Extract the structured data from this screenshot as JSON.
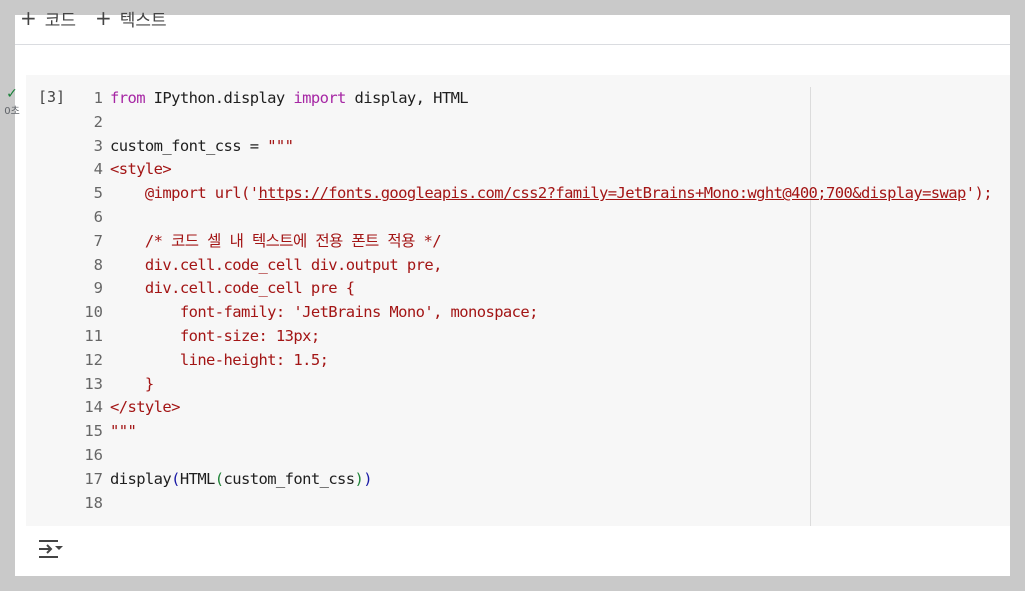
{
  "toolbar": {
    "add_code_label": "코드",
    "add_text_label": "텍스트"
  },
  "cell": {
    "exec_count": "[3]",
    "status_icon": "check-icon",
    "duration": "0초",
    "lines": [
      {
        "n": "1",
        "tokens": [
          {
            "t": "from",
            "c": "k"
          },
          {
            "t": " IPython.display ",
            "c": "txt"
          },
          {
            "t": "import",
            "c": "k"
          },
          {
            "t": " display, HTML",
            "c": "txt"
          }
        ]
      },
      {
        "n": "2",
        "tokens": []
      },
      {
        "n": "3",
        "tokens": [
          {
            "t": "custom_font_css = ",
            "c": "txt"
          },
          {
            "t": "\"\"\"",
            "c": "s"
          }
        ]
      },
      {
        "n": "4",
        "tokens": [
          {
            "t": "<style>",
            "c": "s"
          }
        ]
      },
      {
        "n": "5",
        "tokens": [
          {
            "t": "    @import url('",
            "c": "s"
          },
          {
            "t": "https://fonts.googleapis.com/css2?family=JetBrains+Mono:wght@400;700&display=swap",
            "c": "u"
          },
          {
            "t": "');",
            "c": "s"
          }
        ]
      },
      {
        "n": "6",
        "tokens": []
      },
      {
        "n": "7",
        "tokens": [
          {
            "t": "    /* 코드 셀 내 텍스트에 전용 폰트 적용 */",
            "c": "s"
          }
        ]
      },
      {
        "n": "8",
        "tokens": [
          {
            "t": "    div.cell.code_cell div.output pre,",
            "c": "s"
          }
        ]
      },
      {
        "n": "9",
        "tokens": [
          {
            "t": "    div.cell.code_cell pre {",
            "c": "s"
          }
        ]
      },
      {
        "n": "10",
        "tokens": [
          {
            "t": "        font-family: 'JetBrains Mono', monospace;",
            "c": "s"
          }
        ]
      },
      {
        "n": "11",
        "tokens": [
          {
            "t": "        font-size: 13px;",
            "c": "s"
          }
        ]
      },
      {
        "n": "12",
        "tokens": [
          {
            "t": "        line-height: 1.5;",
            "c": "s"
          }
        ]
      },
      {
        "n": "13",
        "tokens": [
          {
            "t": "    }",
            "c": "s"
          }
        ]
      },
      {
        "n": "14",
        "tokens": [
          {
            "t": "</style>",
            "c": "s"
          }
        ]
      },
      {
        "n": "15",
        "tokens": [
          {
            "t": "\"\"\"",
            "c": "s"
          }
        ]
      },
      {
        "n": "16",
        "tokens": []
      },
      {
        "n": "17",
        "tokens": [
          {
            "t": "display",
            "c": "txt"
          },
          {
            "t": "(",
            "c": "p1"
          },
          {
            "t": "HTML",
            "c": "txt"
          },
          {
            "t": "(",
            "c": "p2"
          },
          {
            "t": "custom_font_css",
            "c": "txt"
          },
          {
            "t": ")",
            "c": "p2"
          },
          {
            "t": ")",
            "c": "p1"
          }
        ]
      },
      {
        "n": "18",
        "tokens": []
      }
    ]
  },
  "output": {
    "toggle_icon": "output-toggle-icon"
  },
  "colors": {
    "keyword": "#a626a4",
    "string": "#a31515",
    "paren_outer": "#1a1aa6",
    "paren_inner": "#22863a",
    "success": "#188038"
  }
}
